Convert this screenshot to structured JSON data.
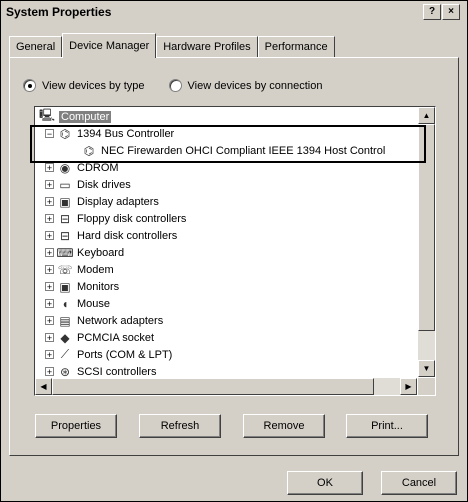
{
  "window": {
    "title": "System Properties",
    "help_btn": "?",
    "close_btn": "×"
  },
  "tabs": [
    {
      "label": "General"
    },
    {
      "label": "Device Manager"
    },
    {
      "label": "Hardware Profiles"
    },
    {
      "label": "Performance"
    }
  ],
  "view": {
    "by_type": "View devices by type",
    "by_connection": "View devices by connection"
  },
  "tree": {
    "root": "Computer",
    "items": [
      {
        "label": "1394 Bus Controller",
        "icon": "bus-controller-icon",
        "expander": "−"
      },
      {
        "label": "NEC Firewarden OHCI Compliant IEEE 1394 Host Control",
        "icon": "host-controller-icon",
        "expander": ""
      },
      {
        "label": "CDROM",
        "icon": "cdrom-icon",
        "expander": "+"
      },
      {
        "label": "Disk drives",
        "icon": "disk-drive-icon",
        "expander": "+"
      },
      {
        "label": "Display adapters",
        "icon": "display-adapter-icon",
        "expander": "+"
      },
      {
        "label": "Floppy disk controllers",
        "icon": "floppy-controller-icon",
        "expander": "+"
      },
      {
        "label": "Hard disk controllers",
        "icon": "hard-disk-controller-icon",
        "expander": "+"
      },
      {
        "label": "Keyboard",
        "icon": "keyboard-icon",
        "expander": "+"
      },
      {
        "label": "Modem",
        "icon": "modem-icon",
        "expander": "+"
      },
      {
        "label": "Monitors",
        "icon": "monitor-icon",
        "expander": "+"
      },
      {
        "label": "Mouse",
        "icon": "mouse-icon",
        "expander": "+"
      },
      {
        "label": "Network adapters",
        "icon": "network-adapter-icon",
        "expander": "+"
      },
      {
        "label": "PCMCIA socket",
        "icon": "pcmcia-icon",
        "expander": "+"
      },
      {
        "label": "Ports (COM & LPT)",
        "icon": "ports-icon",
        "expander": "+"
      },
      {
        "label": "SCSI controllers",
        "icon": "scsi-icon",
        "expander": "+"
      }
    ]
  },
  "buttons": {
    "properties": "Properties",
    "refresh": "Refresh",
    "remove": "Remove",
    "print": "Print...",
    "ok": "OK",
    "cancel": "Cancel"
  }
}
